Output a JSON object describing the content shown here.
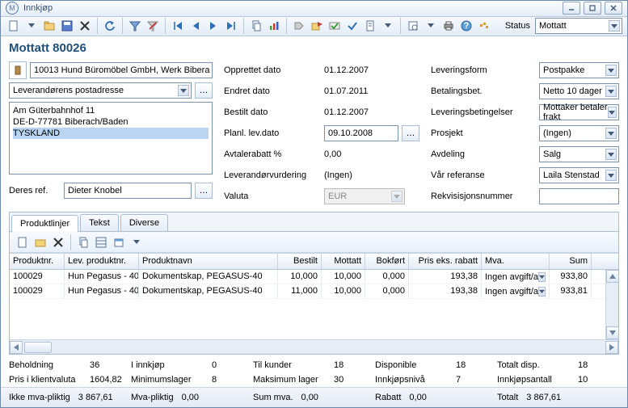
{
  "window": {
    "title": "Innkjøp"
  },
  "toolbar": {
    "status_label": "Status",
    "status_value": "Mottatt"
  },
  "heading": "Mottatt 80026",
  "supplier": {
    "code_name": "10013 Hund Büromöbel GmbH, Werk Bibera",
    "address_select": "Leverandørens postadresse",
    "addr1": "Am Güterbahnhof 11",
    "addr2": "DE-D-77781 Biberach/Baden",
    "addr3": "TYSKLAND",
    "deres_ref_label": "Deres ref.",
    "deres_ref": "Dieter Knobel"
  },
  "mid": {
    "opprettet_l": "Opprettet dato",
    "opprettet_v": "01.12.2007",
    "endret_l": "Endret dato",
    "endret_v": "01.07.2011",
    "bestilt_l": "Bestilt dato",
    "bestilt_v": "01.12.2007",
    "planl_l": "Planl. lev.dato",
    "planl_v": "09.10.2008",
    "avtaler_l": "Avtalerabatt %",
    "avtaler_v": "0,00",
    "levvurd_l": "Leverandørvurdering",
    "levvurd_v": "(Ingen)",
    "valuta_l": "Valuta",
    "valuta_v": "EUR"
  },
  "right": {
    "levform_l": "Leveringsform",
    "levform_v": "Postpakke",
    "betbet_l": "Betalingsbet.",
    "betbet_v": "Netto 10 dager",
    "levbet_l": "Leveringsbetingelser",
    "levbet_v": "Mottaker betaler frakt",
    "prosj_l": "Prosjekt",
    "prosj_v": "(Ingen)",
    "avd_l": "Avdeling",
    "avd_v": "Salg",
    "varref_l": "Vår referanse",
    "varref_v": "Laila Stenstad",
    "rekv_l": "Rekvisisjonsnummer",
    "rekv_v": ""
  },
  "tabs": {
    "t1": "Produktlinjer",
    "t2": "Tekst",
    "t3": "Diverse"
  },
  "grid": {
    "h_pn": "Produktnr.",
    "h_lp": "Lev. produktnr.",
    "h_nm": "Produktnavn",
    "h_be": "Bestilt",
    "h_mo": "Mottatt",
    "h_bo": "Bokført",
    "h_pr": "Pris eks. rabatt",
    "h_mv": "Mva.",
    "h_su": "Sum",
    "rows": [
      {
        "pn": "100029",
        "lp": "Hun Pegasus - 40",
        "nm": "Dokumentskap, PEGASUS-40",
        "be": "10,000",
        "mo": "10,000",
        "bo": "0,000",
        "pr": "193,38",
        "mv": "Ingen avgift/a",
        "su": "933,80"
      },
      {
        "pn": "100029",
        "lp": "Hun Pegasus - 40",
        "nm": "Dokumentskap, PEGASUS-40",
        "be": "11,000",
        "mo": "10,000",
        "bo": "0,000",
        "pr": "193,38",
        "mv": "Ingen avgift/a",
        "su": "933,81"
      }
    ]
  },
  "summary": {
    "beh_l": "Beholdning",
    "beh_v": "36",
    "inn_l": "I innkjøp",
    "inn_v": "0",
    "tilk_l": "Til kunder",
    "tilk_v": "18",
    "disp_l": "Disponible",
    "disp_v": "18",
    "tdisp_l": "Totalt disp.",
    "tdisp_v": "18",
    "pkv_l": "Pris i klientvaluta",
    "pkv_v": "1604,82",
    "min_l": "Minimumslager",
    "min_v": "8",
    "max_l": "Maksimum lager",
    "max_v": "30",
    "innn_l": "Innkjøpsnivå",
    "innn_v": "7",
    "inna_l": "Innkjøpsantall",
    "inna_v": "10"
  },
  "totals": {
    "ikke_l": "Ikke mva-pliktig",
    "ikke_v": "3 867,61",
    "mva_l": "Mva-pliktig",
    "mva_v": "0,00",
    "sum_l": "Sum mva.",
    "sum_v": "0,00",
    "rab_l": "Rabatt",
    "rab_v": "0,00",
    "tot_l": "Totalt",
    "tot_v": "3 867,61"
  }
}
